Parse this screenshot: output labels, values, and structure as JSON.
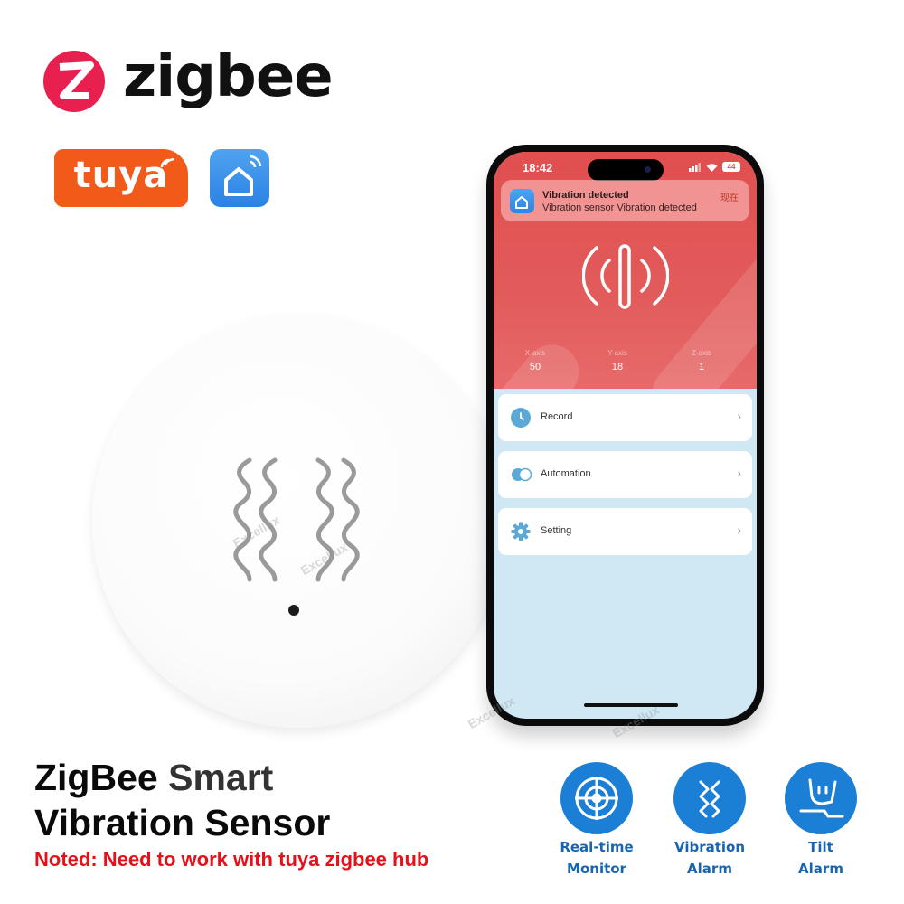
{
  "brands": {
    "zigbee_wordmark": "zigbee",
    "tuya_wordmark": "tuya",
    "smart_life_icon": "home-wifi-icon",
    "colors": {
      "zigbee_red": "#e8204f",
      "tuya_orange": "#f25a1a",
      "smart_life_blue": "#2a82e4"
    }
  },
  "product": {
    "name": "ZigBee Smart Vibration Sensor",
    "sensor_icon": "vibration-waves-icon"
  },
  "phone": {
    "status_bar": {
      "time": "18:42",
      "battery": "44",
      "signal_icon": "cellular-signal-icon",
      "wifi_icon": "wifi-icon"
    },
    "notification": {
      "title": "Vibration detected",
      "body": "Vibration sensor  Vibration detected",
      "time": "现在"
    },
    "axes": [
      {
        "label": "X-axis",
        "value": "50"
      },
      {
        "label": "Y-axis",
        "value": "18"
      },
      {
        "label": "Z-axis",
        "value": "1"
      }
    ],
    "menu": [
      {
        "label": "Record",
        "icon": "clock-icon"
      },
      {
        "label": "Automation",
        "icon": "toggle-icon"
      },
      {
        "label": "Setting",
        "icon": "gear-icon"
      }
    ],
    "colors": {
      "header_red": "#e14f4f",
      "body_blue": "#cfe8f4",
      "icon_blue": "#5aa9d6"
    }
  },
  "headline": {
    "line1_a": "ZigBee",
    "line1_b": " Smart",
    "line2": "Vibration Sensor",
    "note": "Noted: Need to work with tuya zigbee hub"
  },
  "features": [
    {
      "line1": "Real-time",
      "line2": "Monitor",
      "icon": "radar-icon"
    },
    {
      "line1": "Vibration",
      "line2": "Alarm",
      "icon": "vibration-icon"
    },
    {
      "line1": "Tilt",
      "line2": "Alarm",
      "icon": "tilt-icon"
    }
  ],
  "watermark": "Excellux"
}
